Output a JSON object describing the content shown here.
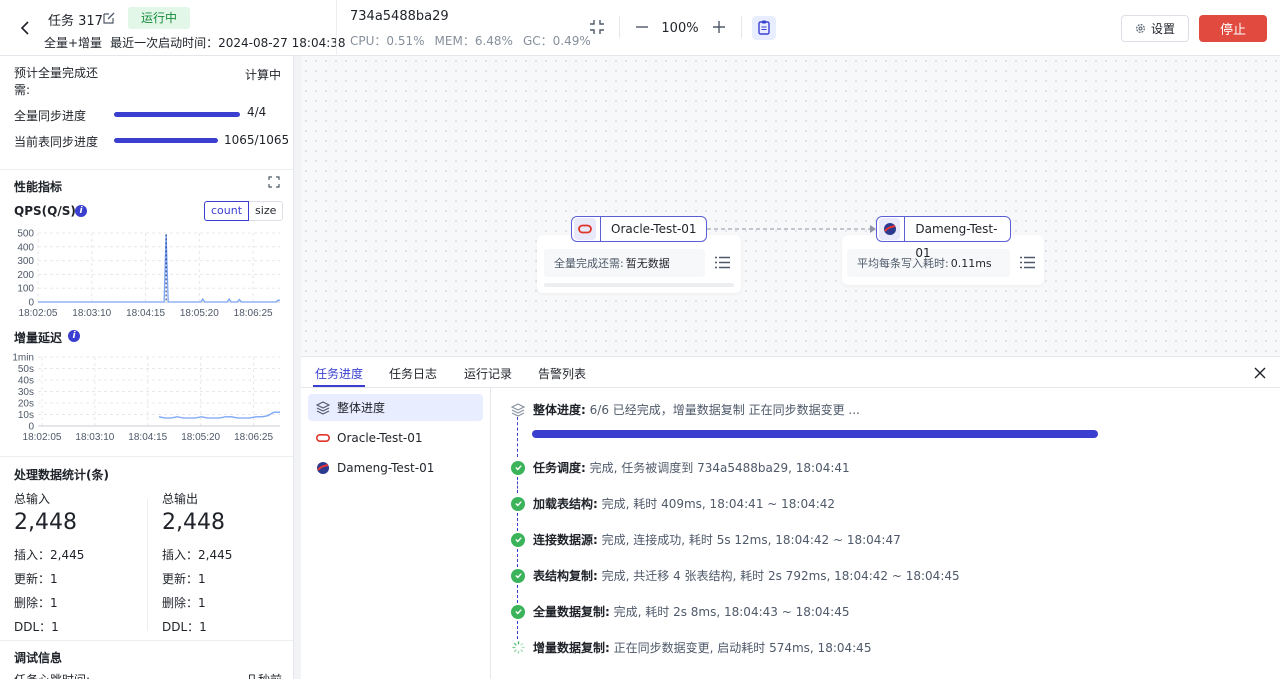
{
  "header": {
    "task_name": "任务 317",
    "status": "运行中",
    "sync_type": "全量+增量",
    "last_start_label": "最近一次启动时间：",
    "last_start_time": "2024-08-27 18:04:38",
    "agent_id": "734a5488ba29",
    "cpu": "CPU：0.51%",
    "mem": "MEM：6.48%",
    "gc": "GC：0.49%",
    "zoom": "100%",
    "settings_label": "设置",
    "stop_label": "停止"
  },
  "left": {
    "eta_label": "预计全量完成还需:",
    "eta_value": "计算中",
    "full_progress_label": "全量同步进度",
    "full_progress_value": "4/4",
    "full_progress": 1.0,
    "table_progress_label": "当前表同步进度",
    "table_progress_value": "1065/1065",
    "table_progress": 1.0,
    "metrics_title": "性能指标",
    "qps_label": "QPS(Q/S)",
    "seg_count": "count",
    "seg_size": "size",
    "latency_label": "增量延迟",
    "stats_title": "处理数据统计(条)",
    "input": {
      "title": "总输入",
      "total": "2,448",
      "insert": "插入：2,445",
      "update": "更新：1",
      "delete": "删除：1",
      "ddl": "DDL：1"
    },
    "output": {
      "title": "总输出",
      "total": "2,448",
      "insert": "插入：2,445",
      "update": "更新：1",
      "delete": "删除：1",
      "ddl": "DDL：1"
    },
    "debug_title": "调试信息",
    "heartbeat_label": "任务心跳时间:",
    "heartbeat_value": "几秒前"
  },
  "chart_data": [
    {
      "type": "line",
      "title": "QPS(Q/S)",
      "x": [
        "18:02:05",
        "18:03:10",
        "18:04:15",
        "18:05:20",
        "18:06:25"
      ],
      "yticks": [
        "500",
        "400",
        "300",
        "200",
        "100",
        "0"
      ],
      "ylim": [
        0,
        500
      ],
      "series": [
        {
          "values": [
            0,
            0,
            0,
            0,
            0,
            0,
            0,
            0,
            0,
            0,
            0,
            0,
            0,
            0,
            0,
            0,
            0,
            0,
            0,
            0,
            0,
            0,
            0,
            0,
            0,
            0,
            0,
            0,
            0,
            0,
            0,
            0,
            0,
            0,
            0,
            0,
            0,
            0,
            0,
            0,
            0,
            0,
            0,
            0,
            0,
            0,
            0,
            0,
            0,
            0,
            0,
            0,
            0,
            0,
            0,
            0,
            0,
            0,
            0,
            0,
            0,
            0,
            0,
            490,
            0,
            0,
            0,
            0,
            0,
            0,
            0,
            0,
            0,
            0,
            0,
            0,
            0,
            0,
            0,
            0,
            0,
            22,
            0,
            0,
            0,
            0,
            0,
            0,
            0,
            0,
            0,
            0,
            0,
            0,
            22,
            0,
            0,
            0,
            0,
            18,
            0,
            0,
            0,
            0,
            0,
            0,
            0,
            0,
            0,
            0,
            0,
            0,
            0,
            0,
            0,
            0,
            0,
            0,
            12,
            14
          ]
        }
      ]
    },
    {
      "type": "line",
      "title": "增量延迟",
      "x": [
        "18:02:05",
        "18:03:10",
        "18:04:15",
        "18:05:20",
        "18:06:25"
      ],
      "yticks": [
        "1min",
        "50s",
        "40s",
        "30s",
        "20s",
        "10s",
        "0"
      ],
      "ylim": [
        0,
        60
      ],
      "series": [
        {
          "values": [
            null,
            null,
            null,
            null,
            null,
            null,
            null,
            null,
            null,
            null,
            null,
            null,
            null,
            null,
            null,
            null,
            null,
            null,
            null,
            null,
            8,
            7,
            7,
            8,
            7,
            7,
            7,
            8,
            7,
            7,
            7,
            8,
            8,
            7,
            7,
            7,
            8,
            8,
            9,
            12,
            12
          ]
        }
      ]
    }
  ],
  "canvas": {
    "source": {
      "name": "Oracle-Test-01",
      "stat_label": "全量完成还需:",
      "stat_value": "暂无数据"
    },
    "target": {
      "name": "Dameng-Test-01",
      "stat_label": "平均每条写入耗时:",
      "stat_value": "0.11ms"
    }
  },
  "bottom": {
    "tabs": [
      "任务进度",
      "任务日志",
      "运行记录",
      "告警列表"
    ],
    "side_items": [
      "整体进度",
      "Oracle-Test-01",
      "Dameng-Test-01"
    ],
    "overall": {
      "title": "整体进度:",
      "text": "6/6 已经完成，增量数据复制 正在同步数据变更 ...",
      "progress": 1.0
    },
    "steps": [
      {
        "title": "任务调度:",
        "text": "完成, 任务被调度到 734a5488ba29, 18:04:41",
        "status": "done"
      },
      {
        "title": "加载表结构:",
        "text": "完成, 耗时 409ms, 18:04:41 ~ 18:04:42",
        "status": "done"
      },
      {
        "title": "连接数据源:",
        "text": "完成, 连接成功, 耗时 5s 12ms, 18:04:42 ~ 18:04:47",
        "status": "done"
      },
      {
        "title": "表结构复制:",
        "text": "完成, 共迁移 4 张表结构, 耗时 2s 792ms, 18:04:42 ~ 18:04:45",
        "status": "done"
      },
      {
        "title": "全量数据复制:",
        "text": "完成, 耗时 2s 8ms, 18:04:43 ~ 18:04:45",
        "status": "done"
      },
      {
        "title": "增量数据复制:",
        "text": "正在同步数据变更, 启动耗时 574ms, 18:04:45",
        "status": "running"
      }
    ]
  },
  "colors": {
    "accent": "#3a3fcf",
    "success": "#3ab35b",
    "danger": "#e14a3f",
    "running_bg": "#e3f7e8",
    "chart_line": "#7aa5f5"
  }
}
